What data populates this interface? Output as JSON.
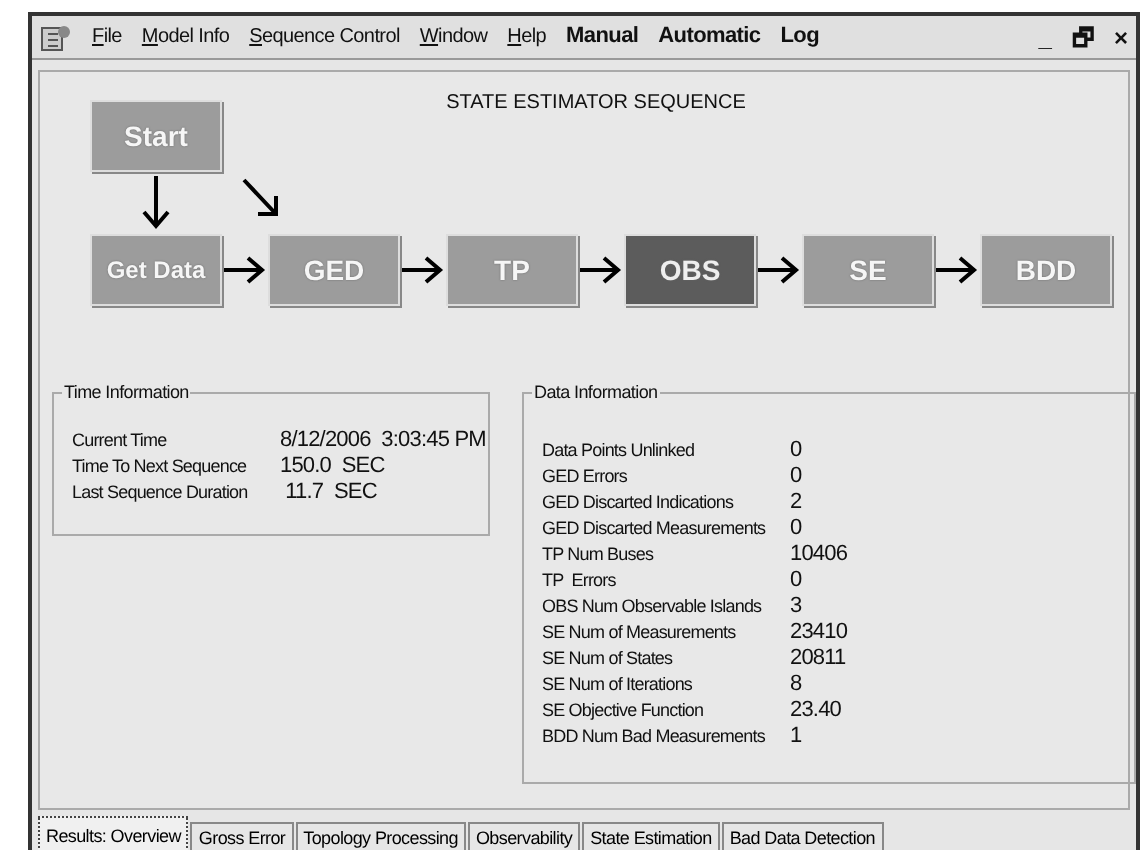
{
  "menu": [
    {
      "label": "File",
      "kind": "menu"
    },
    {
      "label": "Model Info",
      "kind": "menu"
    },
    {
      "label": "Sequence Control",
      "kind": "menu"
    },
    {
      "label": "Window",
      "kind": "menu"
    },
    {
      "label": "Help",
      "kind": "menu"
    },
    {
      "label": "Manual",
      "kind": "mode"
    },
    {
      "label": "Automatic",
      "kind": "mode"
    },
    {
      "label": "Log",
      "kind": "mode"
    }
  ],
  "window_controls": [
    "_",
    "🗗",
    "×"
  ],
  "sequence": {
    "title": "STATE ESTIMATOR SEQUENCE",
    "start": {
      "label": "Start",
      "selected": false
    },
    "stages": [
      {
        "label": "Get Data",
        "selected": false
      },
      {
        "label": "GED",
        "selected": false
      },
      {
        "label": "TP",
        "selected": false
      },
      {
        "label": "OBS",
        "selected": true
      },
      {
        "label": "SE",
        "selected": false
      },
      {
        "label": "BDD",
        "selected": false
      }
    ]
  },
  "time_information": {
    "title": "Time Information",
    "rows": [
      {
        "label": "Current Time",
        "value": "8/12/2006  3:03:45 PM"
      },
      {
        "label": "Time To Next Sequence",
        "value": "150.0  SEC"
      },
      {
        "label": "Last Sequence Duration",
        "value": " 11.7  SEC"
      }
    ]
  },
  "data_information": {
    "title": "Data Information",
    "rows": [
      {
        "label": "Data Points Unlinked",
        "value": "0"
      },
      {
        "label": "GED Errors",
        "value": "0"
      },
      {
        "label": "GED Discarted Indications",
        "value": "2"
      },
      {
        "label": "GED Discarted Measurements",
        "value": "0"
      },
      {
        "label": "TP Num Buses",
        "value": "10406"
      },
      {
        "label": "TP  Errors",
        "value": "0"
      },
      {
        "label": "OBS Num Observable Islands",
        "value": "3"
      },
      {
        "label": "SE Num of Measurements",
        "value": "23410"
      },
      {
        "label": "SE Num of States",
        "value": "20811"
      },
      {
        "label": "SE Num of Iterations",
        "value": "8"
      },
      {
        "label": "SE Objective Function",
        "value": "23.40"
      },
      {
        "label": "BDD Num Bad Measurements",
        "value": "1"
      }
    ]
  },
  "tabs": [
    {
      "label": "Results: Overview",
      "selected": true
    },
    {
      "label": "Gross Error",
      "selected": false
    },
    {
      "label": "Topology Processing",
      "selected": false
    },
    {
      "label": "Observability",
      "selected": false
    },
    {
      "label": "State Estimation",
      "selected": false
    },
    {
      "label": "Bad Data Detection",
      "selected": false
    }
  ]
}
